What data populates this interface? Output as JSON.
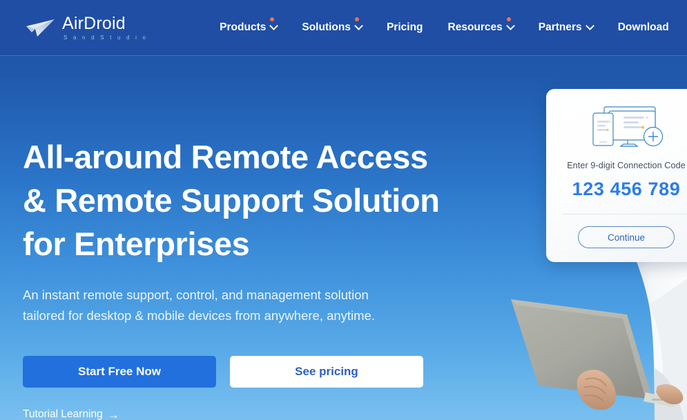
{
  "brand": {
    "name": "AirDroid",
    "tagline": "S a n d   S t u d i o",
    "logo_icon": "paper-plane-icon"
  },
  "nav": {
    "items": [
      {
        "label": "Products",
        "has_caret": true,
        "has_dot": true
      },
      {
        "label": "Solutions",
        "has_caret": true,
        "has_dot": true
      },
      {
        "label": "Pricing",
        "has_caret": false,
        "has_dot": false
      },
      {
        "label": "Resources",
        "has_caret": true,
        "has_dot": true
      },
      {
        "label": "Partners",
        "has_caret": true,
        "has_dot": false
      },
      {
        "label": "Download",
        "has_caret": false,
        "has_dot": false
      }
    ]
  },
  "hero": {
    "headline_line1": "All-around Remote Access",
    "headline_line2": "& Remote Support Solution",
    "headline_line3": "for Enterprises",
    "subhead_line1": "An instant remote support, control, and management solution",
    "subhead_line2": "tailored for desktop & mobile devices from anywhere, anytime.",
    "primary_cta": "Start Free Now",
    "secondary_cta": "See pricing",
    "tutorial_link": "Tutorial Learning",
    "tutorial_arrow": "→"
  },
  "connection_card": {
    "illustration_icon": "monitor-tablet-plus-icon",
    "label": "Enter 9-digit Connection Code",
    "code": "123 456 789",
    "continue_label": "Continue"
  },
  "photo": {
    "alt_icon": "person-holding-laptop-photo"
  },
  "colors": {
    "header_bg": "#1f4ea4",
    "hero_gradient_top": "#1e4da2",
    "hero_gradient_bottom": "#79c0f0",
    "primary_button": "#2170dd",
    "secondary_button_text": "#2f5fc4",
    "badge_dot": "#ef7050",
    "code_blue": "#2b7de9",
    "continue_border": "#5a87c6"
  }
}
